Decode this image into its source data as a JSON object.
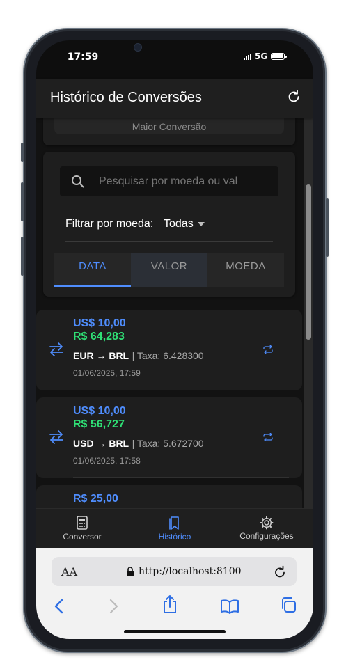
{
  "status": {
    "time": "17:59",
    "network": "5G"
  },
  "header": {
    "title": "Histórico de Conversões"
  },
  "stats": {
    "label": "Maior Conversão"
  },
  "search": {
    "placeholder": "Pesquisar por moeda ou valor"
  },
  "filter": {
    "label": "Filtrar por moeda:",
    "value": "Todas"
  },
  "sort_tabs": [
    {
      "label": "DATA",
      "active": true
    },
    {
      "label": "VALOR",
      "active": false
    },
    {
      "label": "MOEDA",
      "active": false
    }
  ],
  "conversions": [
    {
      "from_amount": "US$ 10,00",
      "to_amount": "R$ 64,283",
      "pair": "EUR → BRL",
      "rate": "| Taxa: 6.428300",
      "datetime": "01/06/2025, 17:59"
    },
    {
      "from_amount": "US$ 10,00",
      "to_amount": "R$ 56,727",
      "pair": "USD → BRL",
      "rate": "| Taxa: 5.672700",
      "datetime": "01/06/2025, 17:58"
    },
    {
      "from_amount": "R$ 25,00"
    }
  ],
  "tabbar": [
    {
      "label": "Conversor",
      "icon": "calculator-icon",
      "active": false
    },
    {
      "label": "Histórico",
      "icon": "bookmark-icon",
      "active": true
    },
    {
      "label": "Configurações",
      "icon": "gear-icon",
      "active": false
    }
  ],
  "browser": {
    "text_size": "AA",
    "url": "http://localhost:8100"
  },
  "colors": {
    "accent": "#4f8dfd",
    "success": "#2fdf75",
    "background": "#121212",
    "surface": "#1e1e1e"
  }
}
